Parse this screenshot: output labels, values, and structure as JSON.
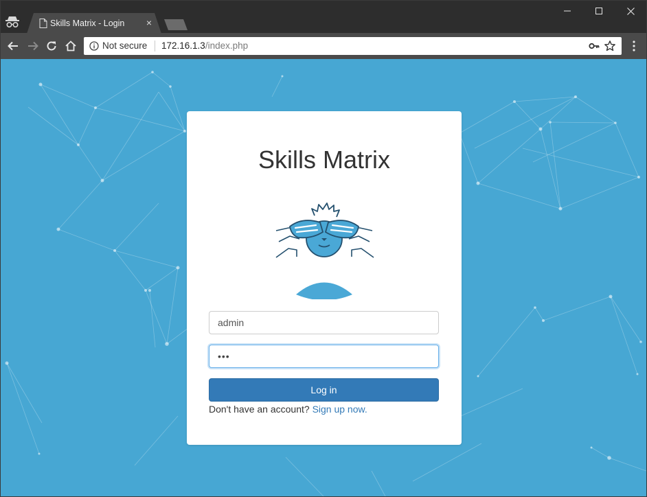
{
  "browser": {
    "tab_title": "Skills Matrix - Login",
    "tab_close": "×",
    "security_label": "Not secure",
    "url_host": "172.16.1.3",
    "url_path": "/index.php"
  },
  "login": {
    "title": "Skills Matrix",
    "username_value": "admin",
    "password_mask": "•••",
    "login_button": "Log in",
    "signup_prompt": "Don't have an account?",
    "signup_link": "Sign up now."
  },
  "colors": {
    "page_background": "#47a7d3",
    "primary_button": "#337ab7",
    "link": "#337ab7"
  }
}
